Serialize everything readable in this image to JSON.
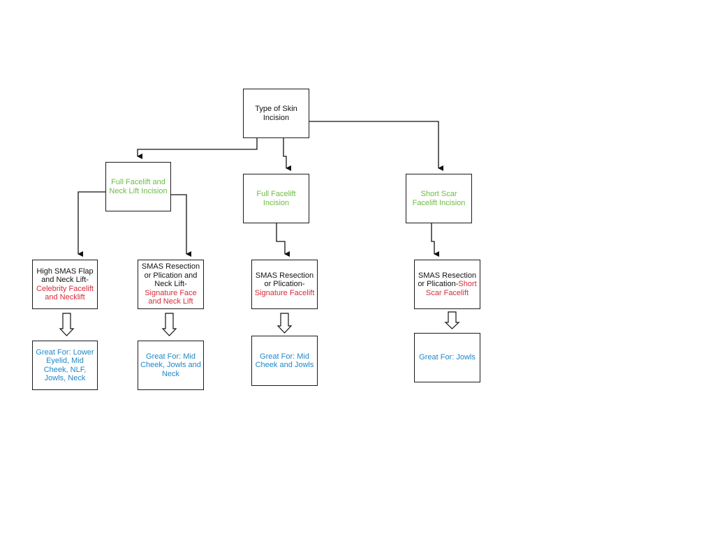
{
  "diagram": {
    "root": {
      "label": "Type of Skin Incision"
    },
    "incisions": [
      {
        "label": "Full Facelift and Neck Lift Incision",
        "color": "#6dbb45"
      },
      {
        "label": "Full Facelift Incision",
        "color": "#6dbb45"
      },
      {
        "label": "Short Scar Facelift Incision",
        "color": "#6dbb45"
      }
    ],
    "techniques": [
      {
        "prefix": "High SMAS Flap and Neck Lift-",
        "name": "Celebrity Facelift and Necklift"
      },
      {
        "prefix": "SMAS Resection or Plication and Neck Lift-",
        "name": "Signature Face and Neck Lift"
      },
      {
        "prefix": "SMAS Resection or Plication-",
        "name": "Signature Facelift"
      },
      {
        "prefix": "SMAS Resection or Plication-",
        "name": "Short Scar Facelift"
      }
    ],
    "outcomes": [
      {
        "label": "Great For: Lower Eyelid, Mid Cheek, NLF, Jowls, Neck"
      },
      {
        "label": "Great For: Mid Cheek, Jowls and Neck"
      },
      {
        "label": "Great For: Mid Cheek and Jowls"
      },
      {
        "label": "Great For: Jowls"
      }
    ],
    "colors": {
      "incision_text": "#6dbb45",
      "procedure_name_text": "#d62a3a",
      "outcome_text": "#1f87c6",
      "default_text": "#111111",
      "border": "#1a1a1a"
    }
  }
}
